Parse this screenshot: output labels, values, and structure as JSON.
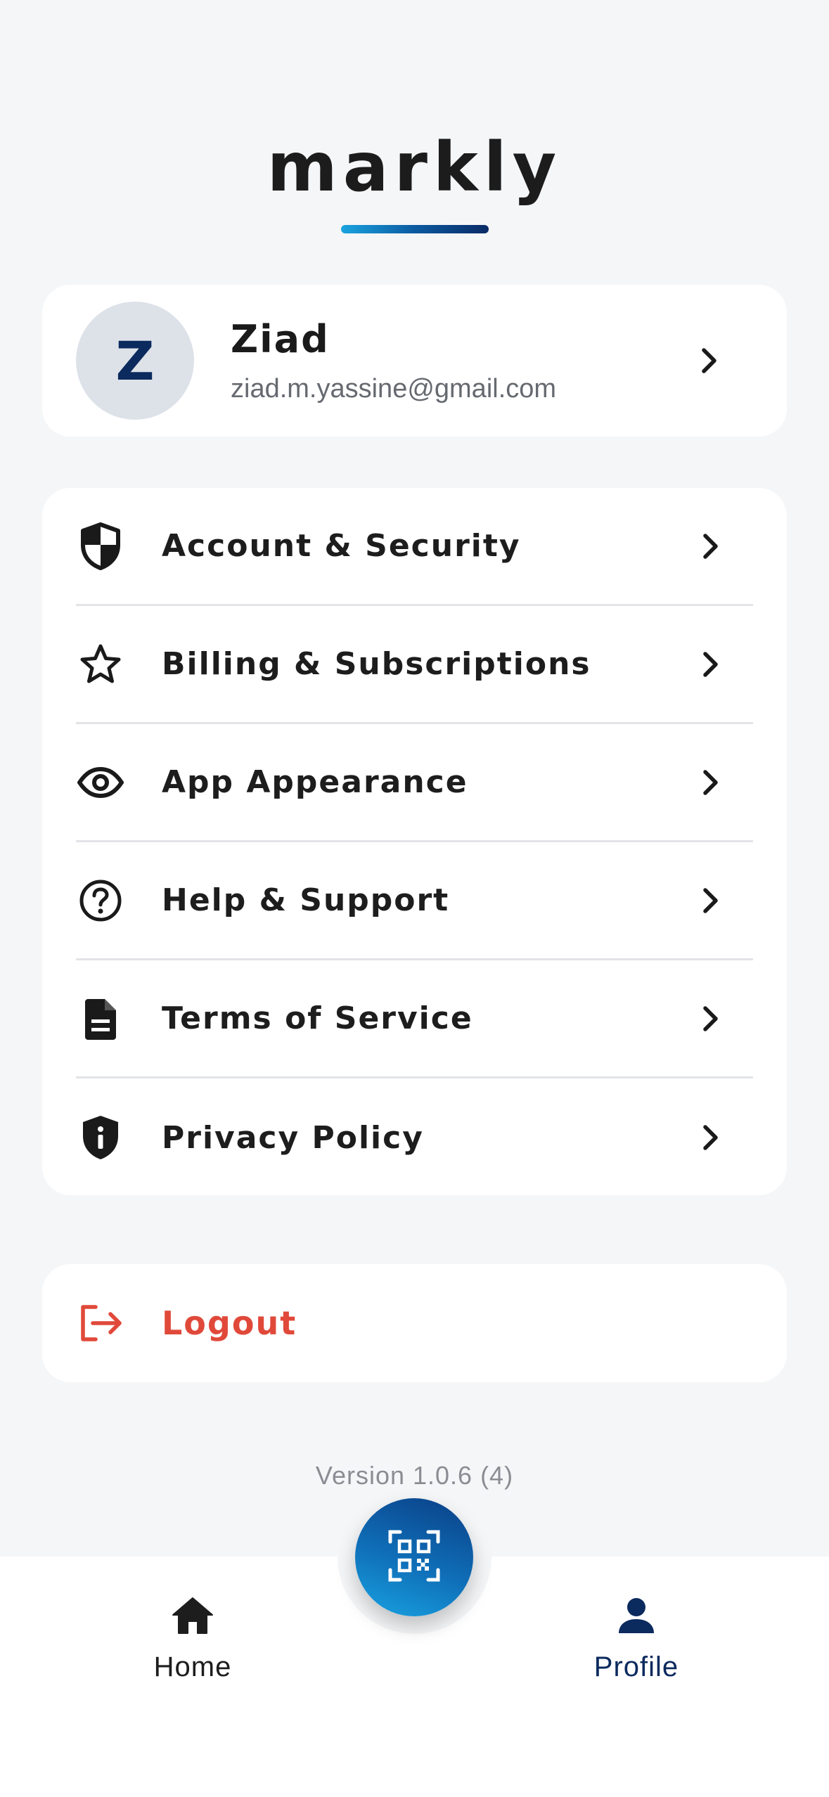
{
  "app": {
    "logo_text": "markly"
  },
  "profile": {
    "avatar_initial": "Z",
    "name": "Ziad",
    "email": "ziad.m.yassine@gmail.com"
  },
  "menu": {
    "items": [
      {
        "label": "Account & Security",
        "icon": "shield-half-icon"
      },
      {
        "label": "Billing & Subscriptions",
        "icon": "star-outline-icon"
      },
      {
        "label": "App Appearance",
        "icon": "eye-icon"
      },
      {
        "label": "Help & Support",
        "icon": "help-circle-icon"
      },
      {
        "label": "Terms of Service",
        "icon": "document-icon"
      },
      {
        "label": "Privacy Policy",
        "icon": "shield-info-icon"
      }
    ]
  },
  "logout": {
    "label": "Logout",
    "icon": "logout-icon",
    "color": "#e0493a"
  },
  "version": "Version 1.0.6 (4)",
  "nav": {
    "home_label": "Home",
    "profile_label": "Profile",
    "scan_icon": "qr-scan-icon",
    "active": "Profile"
  },
  "colors": {
    "brand_dark": "#0b2a5e",
    "brand_light": "#1aa3e0",
    "background": "#f5f6f8",
    "logout_red": "#e0493a"
  }
}
